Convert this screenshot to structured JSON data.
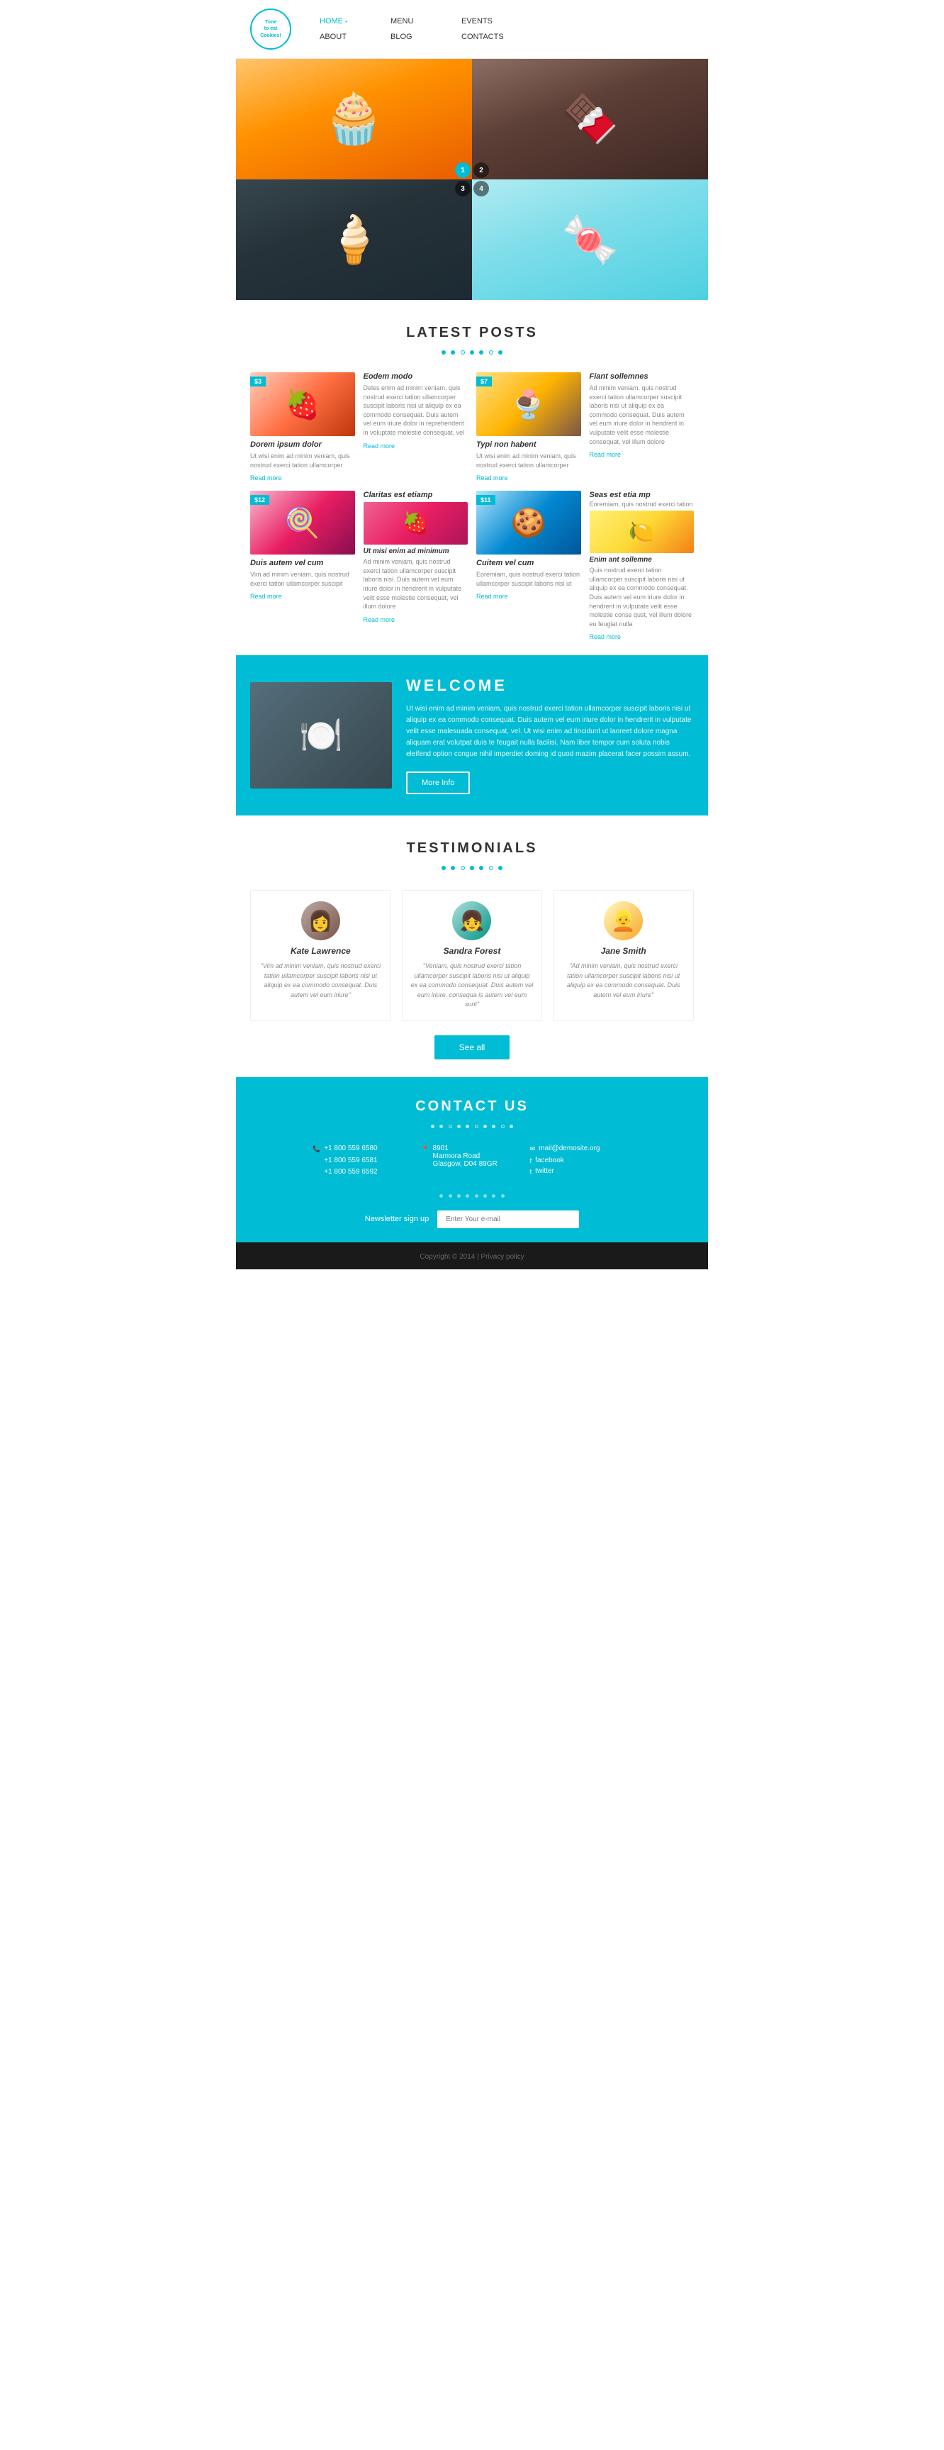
{
  "header": {
    "logo_line1": "Time",
    "logo_line2": "to eat",
    "logo_line3": "Cookies!",
    "nav": [
      {
        "label": "HOME",
        "active": true,
        "col": 1
      },
      {
        "label": "MENU",
        "col": 2
      },
      {
        "label": "EVENTS",
        "col": 3
      },
      {
        "label": "ABOUT",
        "col": 1
      },
      {
        "label": "BLOG",
        "col": 2
      },
      {
        "label": "CONTACTS",
        "col": 3
      }
    ]
  },
  "hero": {
    "slides": [
      {
        "num": "1",
        "active": true
      },
      {
        "num": "2",
        "active": false
      },
      {
        "num": "3",
        "active": false
      },
      {
        "num": "4",
        "active": false
      }
    ]
  },
  "latest_posts": {
    "title": "LATEST POSTS",
    "posts": [
      {
        "type": "image",
        "badge": "$3",
        "img_class": "img-dessert1",
        "title": "Dorem ipsum dolor",
        "text": "Ut wisi enim ad minim veniam, quis nostrud exerci tation ullamcorper",
        "read_more": "Read more"
      },
      {
        "type": "text",
        "title": "Eodem modo",
        "text": "Deles enim ad minim veniam, quis nostrud exerci tation ullamcorper suscipit laboris nisi ut aliquip ex ea commodo consequat. Duis autem vel eum iriure dolor in reprehenderit in voluptate molestie consequat, vel",
        "read_more": "Read more"
      },
      {
        "type": "image",
        "badge": "$7",
        "img_class": "img-dessert3",
        "title": "Typi non habent",
        "text": "Ut wisi enim ad minim veniam, quis nostrud exerci tation ullamcorper",
        "read_more": "Read more"
      },
      {
        "type": "text",
        "title": "Fiant sollemnes",
        "text": "Ad minim veniam, quis nostrud exerci tation ullamcorper suscipit laboris nisi ut aliquip ex ea commodo consequat. Duis autem vel eum iriure dolor in hendrerit in vulputate velit esse molestie consequat, vel illum dolore",
        "read_more": "Read more"
      },
      {
        "type": "image",
        "badge": "$12",
        "img_class": "img-dessert4",
        "title": "Duis autem vel cum",
        "text": "Vim ad minim veniam, quis nostrud exerci tation ullamcorper suscipit",
        "read_more": "Read more"
      },
      {
        "type": "text",
        "title": "Claritas est etiamp",
        "subtitle": "Ut misi enim ad minimum",
        "text": "Ad minim veniam, quis nostrud exerci tation ullamcorper suscipit laboris nisi. Duis autem vel eum iriure dolor in hendrerit in vulputate velit esse molestie consequat, vel illum dolore",
        "read_more": "Read more",
        "has_sub_img": true,
        "sub_img_class": "img-dessert2"
      },
      {
        "type": "image",
        "badge": "$11",
        "img_class": "img-dessert5",
        "title": "Cuitem vel cum",
        "text": "Eoremiam, quis nostrud exerci tation ullamcorper suscipit laboris nisi ut",
        "read_more": "Read more"
      },
      {
        "type": "text",
        "title": "Seas est etia mp",
        "subtitle": "Enim ant sollemne",
        "text_top": "Eoremiam, quis nostrud exerci tation",
        "text_bottom": "Quis nostrud exerci tation ullamcorper suscipit laboris nisi ut aliquip ex ea commodo consequat. Duis autem vel eum iriure dolor in hendrerit in vulputate velit esse molestie conse qust, vel illum dolore eu feugiat nulla",
        "read_more": "Read more",
        "has_sub_img": true,
        "sub_img_class": "img-dessert6"
      }
    ]
  },
  "welcome": {
    "title": "WELCOME",
    "text": "Ut wisi enim ad minim veniam, quis nostrud exerci tation ullamcorper suscipit laboris nisi ut aliquip ex ea commodo consequat. Duis autem vel eum iriure dolor in hendrerit in vulputate velit esse malesuada consequat, vel. Ut wisi enim ad tincidunt ut laoreet dolore magna aliquam erat volutpat duis te feugait nulla facilisi. Nam liber tempor cum soluta nobis eleifend option congue nihil imperdiet doming id quod mazim placerat facer possim assum.",
    "button_label": "More Info"
  },
  "testimonials": {
    "title": "TESTIMONIALS",
    "items": [
      {
        "name": "Kate Lawrence",
        "text": "\"Vim ad minim veniam, quis nostrud exerci tation ullamcorper suscipit laboris nisi ut aliquip ex ea commodo consequat. Duis autem vel eum iriure\""
      },
      {
        "name": "Sandra Forest",
        "text": "\"Veniam, quis nostrud exerci tation ullamcorper suscipit laboris nisi ut aliquip ex ea commodo consequat. Duis autem vel eum iriure. consequa is autem vel eum sunt\""
      },
      {
        "name": "Jane Smith",
        "text": "\"Ad minim veniam, quis nostrud exerci tation ullamcorper suscipit laboris nisi ut aliquip ex ea commodo consequat. Duis autem vel eum iriure\""
      }
    ],
    "see_all_label": "See all"
  },
  "contact": {
    "title": "CONTACT US",
    "phones": [
      "+1 800 559 6580",
      "+1 800 559 6581",
      "+1 800 559 6592"
    ],
    "address_lines": [
      "8901",
      "Marmora Road",
      "Glasgow, D04 89GR"
    ],
    "email": "mail@demosite.org",
    "social": [
      "facebook",
      "twitter"
    ],
    "newsletter_label": "Newsletter sign up",
    "newsletter_placeholder": "Enter Your e-mail"
  },
  "footer": {
    "text": "Copyright © 2014 | Privacy policy"
  }
}
